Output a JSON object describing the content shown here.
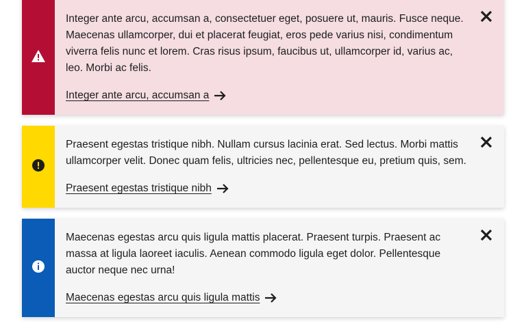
{
  "notices": [
    {
      "type": "warning",
      "icon": "warning-triangle-icon",
      "bar_color": "#b50e34",
      "bg_color": "#f5dde2",
      "text": "Integer ante arcu, accumsan a, consectetuer eget, posuere ut, mauris. Fusce neque. Maecenas ullamcorper, dui et placerat feugiat, eros pede varius nisi, condimentum viverra felis nunc et lorem. Cras risus ipsum, faucibus ut, ullamcorper id, varius ac, leo. Morbi ac felis.",
      "link": "Integer ante arcu, accumsan a"
    },
    {
      "type": "caution",
      "icon": "exclamation-circle-icon",
      "bar_color": "#ffd900",
      "bg_color": "#f5f5f5",
      "text": "Praesent egestas tristique nibh. Nullam cursus lacinia erat. Sed lectus. Morbi mattis ullamcorper velit. Donec quam felis, ultricies nec, pellentesque eu, pretium quis, sem.",
      "link": "Praesent egestas tristique nibh"
    },
    {
      "type": "info",
      "icon": "info-circle-icon",
      "bar_color": "#0a5cb6",
      "bg_color": "#f5f5f5",
      "text": "Maecenas egestas arcu quis ligula mattis placerat. Praesent turpis. Praesent ac massa at ligula laoreet iaculis. Aenean commodo ligula eget dolor. Pellentesque auctor neque nec urna!",
      "link": "Maecenas egestas arcu quis ligula mattis"
    }
  ]
}
